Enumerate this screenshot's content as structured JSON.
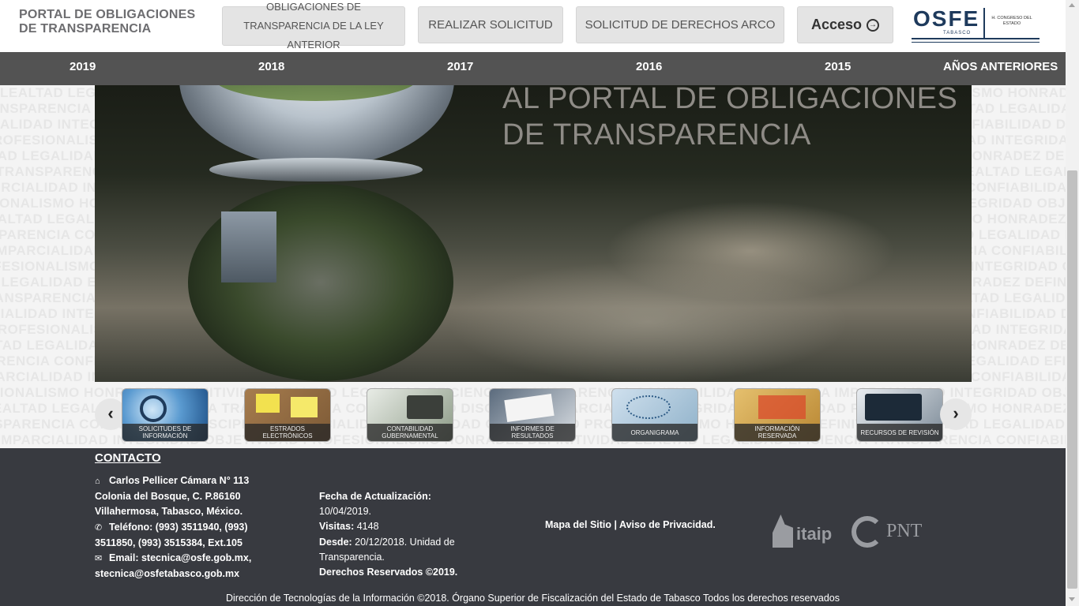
{
  "header": {
    "brand": "PORTAL DE OBLIGACIONES DE TRANSPARENCIA",
    "buttons": {
      "obligaciones_ley_anterior": "OBLIGACIONES DE TRANSPARENCIA DE LA LEY ANTERIOR",
      "realizar_solicitud": "REALIZAR SOLICITUD",
      "solicitud_arco": "SOLICITUD DE DERECHOS ARCO",
      "acceso": "Acceso"
    },
    "logo": {
      "word": "OSFE",
      "sub": "TABASCO",
      "congreso": "H. CONGRESO DEL ESTADO"
    }
  },
  "nav": {
    "items": [
      "2019",
      "2018",
      "2017",
      "2016",
      "2015",
      "AÑOS ANTERIORES"
    ]
  },
  "hero": {
    "line1": "AL PORTAL DE OBLIGACIONES",
    "line2": "DE TRANSPARENCIA"
  },
  "carousel": {
    "items": [
      {
        "label": "SOLICITUDES DE INFORMACIÓN",
        "icon": "magnifier-icon"
      },
      {
        "label": "ESTRADOS ELECTRÓNICOS",
        "icon": "corkboard-icon"
      },
      {
        "label": "CONTABILIDAD GUBERNAMENTAL",
        "icon": "calculator-icon"
      },
      {
        "label": "INFORMES DE RESULTADOS",
        "icon": "document-signing-icon"
      },
      {
        "label": "ORGANIGRAMA",
        "icon": "org-chart-icon"
      },
      {
        "label": "INFORMACIÓN RESERVADA",
        "icon": "folders-icon"
      },
      {
        "label": "RECURSOS DE REVISIÓN",
        "icon": "tablet-chart-icon"
      }
    ]
  },
  "footer": {
    "contact_title": "CONTACTO",
    "address": "Carlos Pellicer Cámara N° 113 Colonia del Bosque, C. P.86160 Villahermosa, Tabasco, México.",
    "phone": "Teléfono: (993) 3511940, (993) 3511850, (993) 3515384, Ext.105",
    "email": "Email: stecnica@osfe.gob.mx, stecnica@osfetabasco.gob.mx",
    "fecha_label": "Fecha de Actualización:",
    "fecha_value": "10/04/2019.",
    "visitas_label": "Visitas:",
    "visitas_value": "4148",
    "desde_label": "Desde:",
    "desde_value": "20/12/2018. Unidad de Transparencia.",
    "derechos": "Derechos Reservados ©2019.",
    "mapa": "Mapa del Sitio",
    "separator": "|",
    "aviso": "Aviso de Privacidad.",
    "itaip": "itaip",
    "pnt": "PNT",
    "copyright": "Dirección de Tecnologías de la Información ©2018. Órgano Superior de Fiscalización del Estado de Tabasco Todos los derechos reservados"
  },
  "colors": {
    "nav_bg": "#535353",
    "footer_bg": "#383a40",
    "brand_text": "#6d6d70",
    "logo_blue": "#1e3a5c"
  }
}
